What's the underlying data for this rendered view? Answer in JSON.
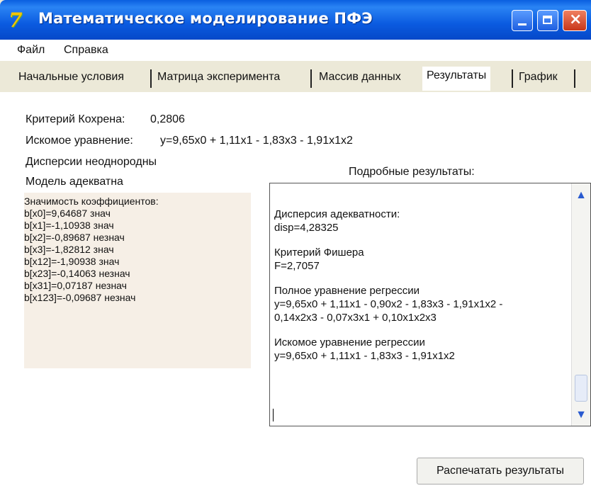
{
  "window": {
    "title": "Математическое моделирование ПФЭ",
    "icon_name": "app-logo-icon"
  },
  "menu": {
    "file": "Файл",
    "help": "Справка"
  },
  "tabs": [
    {
      "label": "Начальные условия"
    },
    {
      "label": "Матрица эксперимента"
    },
    {
      "label": "Массив данных"
    },
    {
      "label": "Результаты",
      "active": true
    },
    {
      "label": "График"
    }
  ],
  "results": {
    "cochran_label": "Критерий Кохрена:",
    "cochran_value": "0,2806",
    "equation_label": "Искомое уравнение:",
    "equation_value": "y=9,65x0 + 1,11x1 - 1,83x3 - 1,91x1x2",
    "dispersion_status": "Дисперсии неоднородны",
    "model_status": "Модель адекватна",
    "details_label": "Подробные результаты:"
  },
  "significance": {
    "header": "Значимость коэффициентов:",
    "items": [
      "b[x0]=9,64687 знач",
      "b[x1]=-1,10938 знач",
      "b[x2]=-0,89687 незнач",
      "b[x3]=-1,82812 знач",
      "b[x12]=-1,90938 знач",
      "b[x23]=-0,14063 незнач",
      "b[x31]=0,07187 незнач",
      "b[x123]=-0,09687 незнач"
    ]
  },
  "details": {
    "adequacy_title": "Дисперсия адекватности:",
    "adequacy_value": "disp=4,28325",
    "fisher_title": "Критерий Фишера",
    "fisher_value": "F=2,7057",
    "full_title": "Полное уравнение регрессии",
    "full_line1": "y=9,65x0 + 1,11x1 - 0,90x2 - 1,83x3 - 1,91x1x2 -",
    "full_line2": "0,14x2x3 - 0,07x3x1 + 0,10x1x2x3",
    "sought_title": "Искомое уравнение регрессии",
    "sought_value": "y=9,65x0 + 1,11x1 - 1,83x3 - 1,91x1x2"
  },
  "buttons": {
    "print": "Распечатать результаты"
  }
}
